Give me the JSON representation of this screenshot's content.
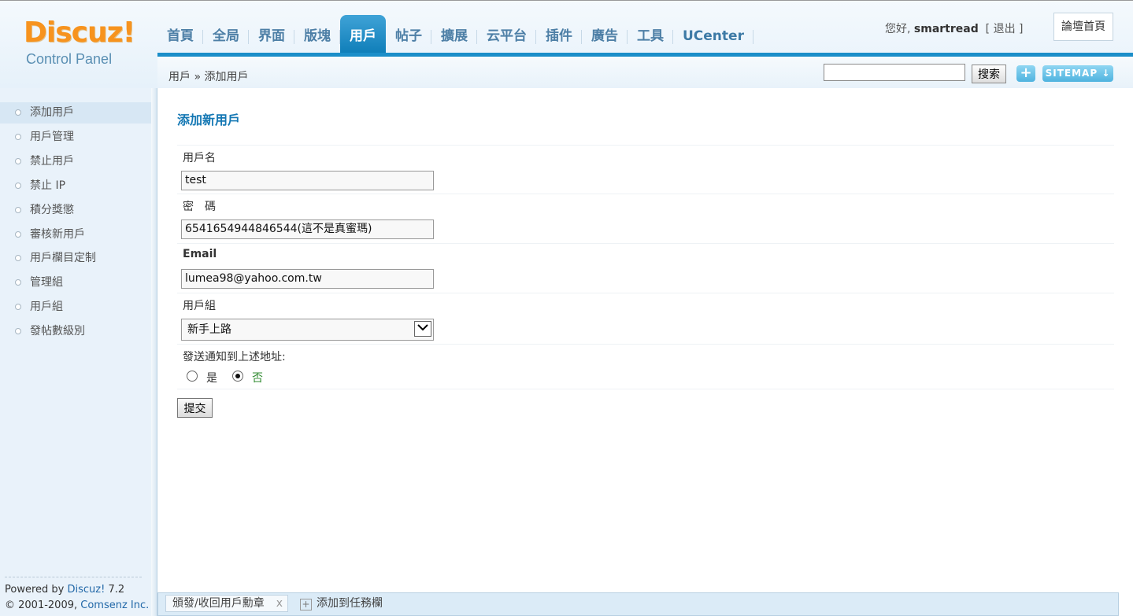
{
  "logo": {
    "brand": "Discuz!",
    "subtitle": "Control Panel"
  },
  "nav": {
    "tabs": [
      "首頁",
      "全局",
      "界面",
      "版塊",
      "用戶",
      "帖子",
      "擴展",
      "云平台",
      "插件",
      "廣告",
      "工具",
      "UCenter"
    ],
    "active_index": 4
  },
  "user": {
    "greeting": "您好,",
    "username": "smartread",
    "logout_open": "[",
    "logout_label": "退出",
    "logout_close": "]",
    "forum_home": "論壇首頁"
  },
  "breadcrumb": {
    "section": "用戶",
    "separator": "»",
    "page": "添加用戶"
  },
  "search": {
    "placeholder": "",
    "button": "搜索"
  },
  "toolbar": {
    "plus": "+",
    "sitemap": "SITEMAP ↓"
  },
  "sidebar": {
    "items": [
      "添加用戶",
      "用戶管理",
      "禁止用戶",
      "禁止 IP",
      "積分獎懲",
      "審核新用戶",
      "用戶欄目定制",
      "管理組",
      "用戶組",
      "發帖數級別"
    ],
    "active_index": 0
  },
  "footer": {
    "powered_prefix": "Powered by ",
    "powered_brand": "Discuz!",
    "powered_version": " 7.2",
    "copyright_prefix": "© 2001-2009, ",
    "copyright_company": "Comsenz Inc."
  },
  "form": {
    "title": "添加新用戶",
    "username_label": "用戶名",
    "username_value": "test",
    "password_label": "密　碼",
    "password_value": "6541654944846544(這不是真蜜瑪)",
    "email_label": "Email",
    "email_value": "lumea98@yahoo.com.tw",
    "group_label": "用戶組",
    "group_value": "新手上路",
    "notify_label": "發送通知到上述地址:",
    "notify_yes": "是",
    "notify_no": "否",
    "notify_selected": "no",
    "submit": "提交"
  },
  "bottombar": {
    "task_label": "頒發/收回用戶勳章",
    "task_close": "x",
    "add_task": "添加到任務欄"
  },
  "colors": {
    "accent": "#1b8ec9",
    "brand_orange": "#f7931e",
    "title_blue": "#1578b4"
  }
}
